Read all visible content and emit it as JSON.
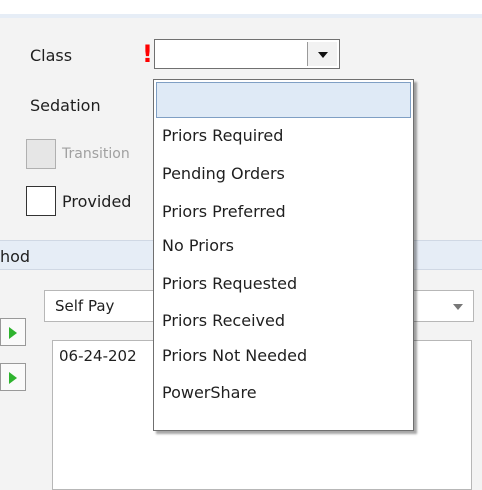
{
  "form": {
    "class_label": "Class",
    "required_marker": "!",
    "sedation_label": "Sedation",
    "transition_label": "Transition",
    "provided_label": "Provided",
    "class_value": ""
  },
  "section": {
    "title": "hod"
  },
  "payment": {
    "method_value": "Self Pay",
    "notes_text": "06-24-202"
  },
  "dropdown": {
    "options": [
      "",
      "Priors Required",
      "Pending Orders",
      "Priors Preferred",
      "No Priors",
      "Priors Requested",
      "Priors Received",
      "Priors Not Needed",
      "PowerShare"
    ]
  },
  "colors": {
    "required": "#ff0000",
    "highlight": "#dfeaf6",
    "section_bg": "#e6edf6",
    "arrow_green": "#2fb32f"
  },
  "icons": {
    "combo_arrow": "chevron-down-icon",
    "side_arrow": "arrow-right-icon"
  }
}
